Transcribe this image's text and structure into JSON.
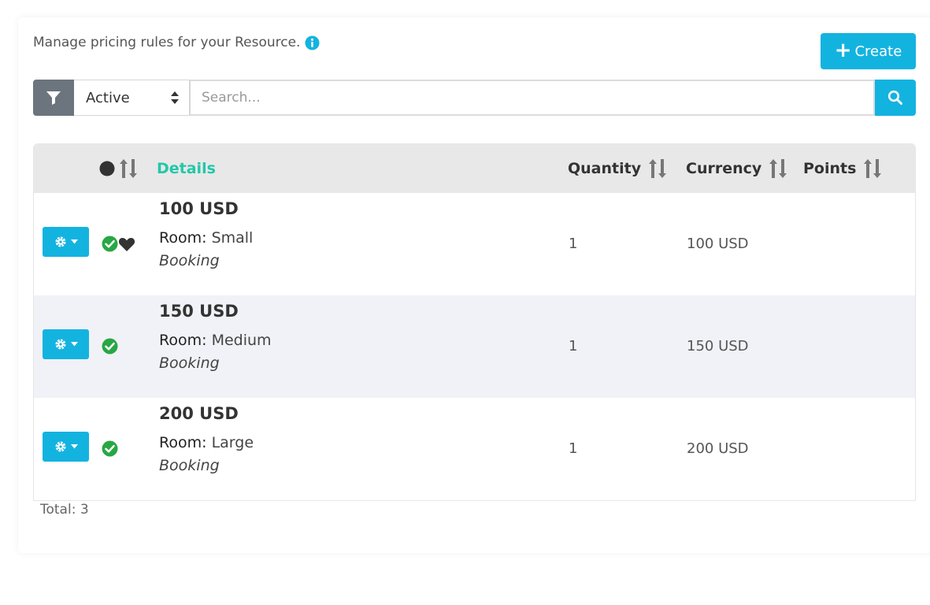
{
  "header": {
    "description": "Manage pricing rules for your Resource.",
    "info_icon": "info-circle-icon",
    "create_label": "Create"
  },
  "toolbar": {
    "filter_icon": "filter-icon",
    "status_selected": "Active",
    "search_placeholder": "Search...",
    "search_icon": "search-icon"
  },
  "table": {
    "columns": {
      "details": "Details",
      "quantity": "Quantity",
      "currency": "Currency",
      "points": "Points"
    },
    "rows": [
      {
        "title": "100 USD",
        "room_label": "Room:",
        "room_value": "Small",
        "type": "Booking",
        "quantity": "1",
        "currency": "100 USD",
        "points": "",
        "active": true,
        "favorite": true
      },
      {
        "title": "150 USD",
        "room_label": "Room:",
        "room_value": "Medium",
        "type": "Booking",
        "quantity": "1",
        "currency": "150 USD",
        "points": "",
        "active": true,
        "favorite": false
      },
      {
        "title": "200 USD",
        "room_label": "Room:",
        "room_value": "Large",
        "type": "Booking",
        "quantity": "1",
        "currency": "200 USD",
        "points": "",
        "active": true,
        "favorite": false
      }
    ]
  },
  "footer": {
    "total": "Total: 3"
  },
  "colors": {
    "accent": "#13b3e0",
    "details_header": "#22c8a8",
    "active_check": "#28a745",
    "filter_button": "#6c757d"
  }
}
